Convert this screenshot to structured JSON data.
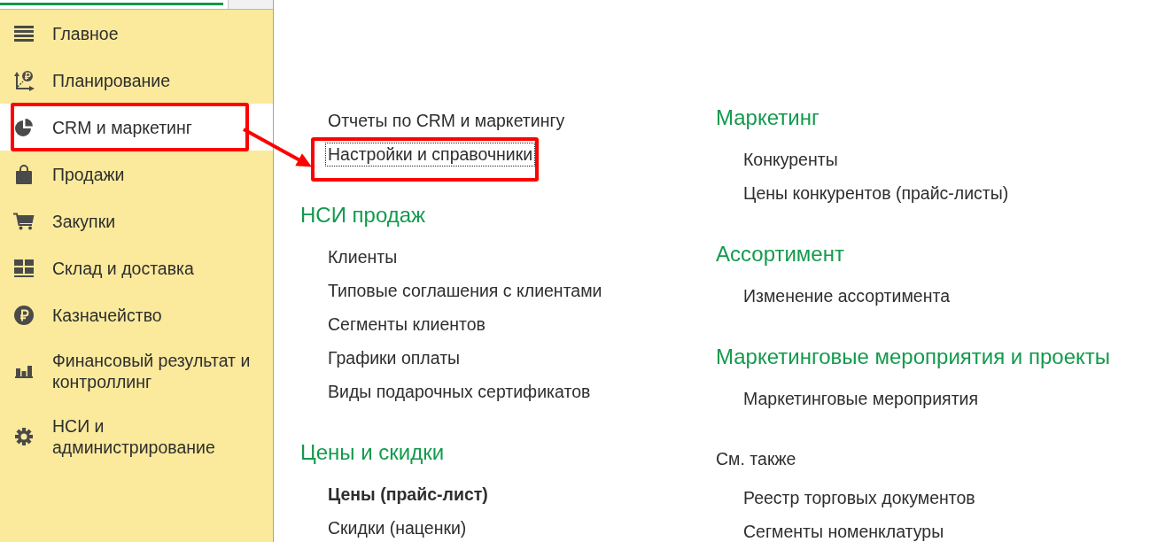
{
  "sidebar": {
    "items": [
      {
        "label": "Главное",
        "selected": false,
        "highlighted": false
      },
      {
        "label": "Планирование",
        "selected": false,
        "highlighted": false
      },
      {
        "label": "CRM и маркетинг",
        "selected": true,
        "highlighted": true
      },
      {
        "label": "Продажи",
        "selected": false,
        "highlighted": false
      },
      {
        "label": "Закупки",
        "selected": false,
        "highlighted": false
      },
      {
        "label": "Склад и доставка",
        "selected": false,
        "highlighted": false
      },
      {
        "label": "Казначейство",
        "selected": false,
        "highlighted": false
      },
      {
        "label": "Финансовый результат и контроллинг",
        "selected": false,
        "highlighted": false
      },
      {
        "label": "НСИ и администрирование",
        "selected": false,
        "highlighted": false
      }
    ]
  },
  "content": {
    "columns": [
      {
        "groups": [
          {
            "kind": "plain",
            "links": [
              {
                "label": "Отчеты по CRM и маркетингу",
                "bold": false,
                "focused": false,
                "highlighted": false
              },
              {
                "label": "Настройки и справочники",
                "bold": false,
                "focused": true,
                "highlighted": true
              }
            ]
          },
          {
            "kind": "section",
            "title": "НСИ продаж",
            "links": [
              {
                "label": "Клиенты",
                "bold": false,
                "focused": false,
                "highlighted": false
              },
              {
                "label": "Типовые соглашения с клиентами",
                "bold": false,
                "focused": false,
                "highlighted": false
              },
              {
                "label": "Сегменты клиентов",
                "bold": false,
                "focused": false,
                "highlighted": false
              },
              {
                "label": "Графики оплаты",
                "bold": false,
                "focused": false,
                "highlighted": false
              },
              {
                "label": "Виды подарочных сертификатов",
                "bold": false,
                "focused": false,
                "highlighted": false
              }
            ]
          },
          {
            "kind": "section",
            "title": "Цены и скидки",
            "links": [
              {
                "label": "Цены (прайс-лист)",
                "bold": true,
                "focused": false,
                "highlighted": false
              },
              {
                "label": "Скидки (наценки)",
                "bold": false,
                "focused": false,
                "highlighted": false
              }
            ]
          }
        ]
      },
      {
        "groups": [
          {
            "kind": "section",
            "title": "Маркетинг",
            "links": [
              {
                "label": "Конкуренты",
                "bold": false,
                "focused": false,
                "highlighted": false
              },
              {
                "label": "Цены конкурентов (прайс-листы)",
                "bold": false,
                "focused": false,
                "highlighted": false
              }
            ]
          },
          {
            "kind": "section",
            "title": "Ассортимент",
            "links": [
              {
                "label": "Изменение ассортимента",
                "bold": false,
                "focused": false,
                "highlighted": false
              }
            ]
          },
          {
            "kind": "section",
            "title": "Маркетинговые мероприятия и проекты",
            "links": [
              {
                "label": "Маркетинговые мероприятия",
                "bold": false,
                "focused": false,
                "highlighted": false
              }
            ]
          },
          {
            "kind": "see_also",
            "title": "См. также",
            "links": [
              {
                "label": "Реестр торговых документов",
                "bold": false,
                "focused": false,
                "highlighted": false
              },
              {
                "label": "Сегменты номенклатуры",
                "bold": false,
                "focused": false,
                "highlighted": false
              }
            ]
          }
        ]
      }
    ]
  }
}
